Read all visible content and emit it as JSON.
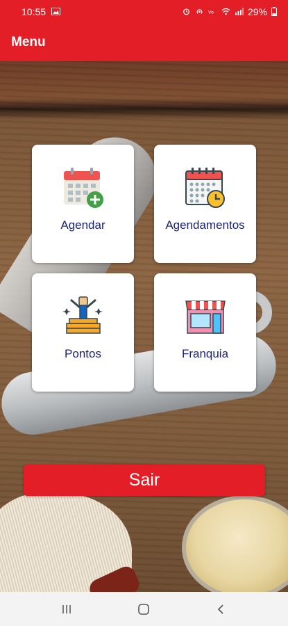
{
  "status_bar": {
    "time": "10:55",
    "battery": "29%",
    "icons": [
      "image-icon",
      "alarm-icon",
      "hotspot-icon",
      "volte-icon",
      "wifi-icon",
      "signal-icon",
      "battery-icon"
    ]
  },
  "app_bar": {
    "title": "Menu"
  },
  "tiles": [
    {
      "label": "Agendar",
      "icon": "calendar-add-icon"
    },
    {
      "label": "Agendamentos",
      "icon": "calendar-clock-icon"
    },
    {
      "label": "Pontos",
      "icon": "rewards-icon"
    },
    {
      "label": "Franquia",
      "icon": "store-icon"
    }
  ],
  "logout": {
    "label": "Sair"
  },
  "colors": {
    "brand_red": "#e41e26",
    "label_blue": "#1a237e",
    "tile_bg": "#ffffff"
  },
  "nav_bar": {
    "icons": [
      "recent-apps-icon",
      "home-icon",
      "back-icon"
    ]
  }
}
